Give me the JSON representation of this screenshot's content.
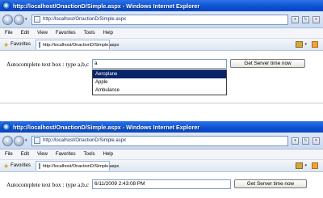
{
  "windows": [
    {
      "title": "http://localhost/OnactionD/Simple.aspx - Windows Internet Explorer",
      "address": "http://localhost/OnactionD/Simple.aspx",
      "menu": [
        "File",
        "Edit",
        "View",
        "Favorites",
        "Tools",
        "Help"
      ],
      "favorites_label": "Favorites",
      "tab_label": "http://localhost/OnactionD/Simple.aspx",
      "autocomplete_label": "Autocomplete text box : type a,b,c",
      "input_value": "a",
      "button_label": "Get Server time now",
      "suggestions": [
        "Aeroplane",
        "Apple",
        "Ambulance"
      ],
      "selected_suggestion": "Aeroplane"
    },
    {
      "title": "http://localhost/OnactionD/Simple.aspx - Windows Internet Explorer",
      "address": "http://localhost/OnactionD/Simple.aspx",
      "menu": [
        "File",
        "Edit",
        "View",
        "Favorites",
        "Tools",
        "Help"
      ],
      "favorites_label": "Favorites",
      "tab_label": "http://localhost/OnactionD/Simple.aspx",
      "autocomplete_label": "Autocomplete text box : type a,b,c",
      "input_value": "6/11/2009 2:43:08 PM",
      "button_label": "Get Server time now"
    }
  ],
  "icons": {
    "ie": "ie-logo-icon",
    "back": "back-arrow-icon",
    "forward": "forward-arrow-icon",
    "favorites": "star-icon",
    "home": "home-icon",
    "feeds": "rss-feed-icon"
  },
  "colors": {
    "titlebar": "#0b4fd2",
    "selection": "#0a246a"
  }
}
